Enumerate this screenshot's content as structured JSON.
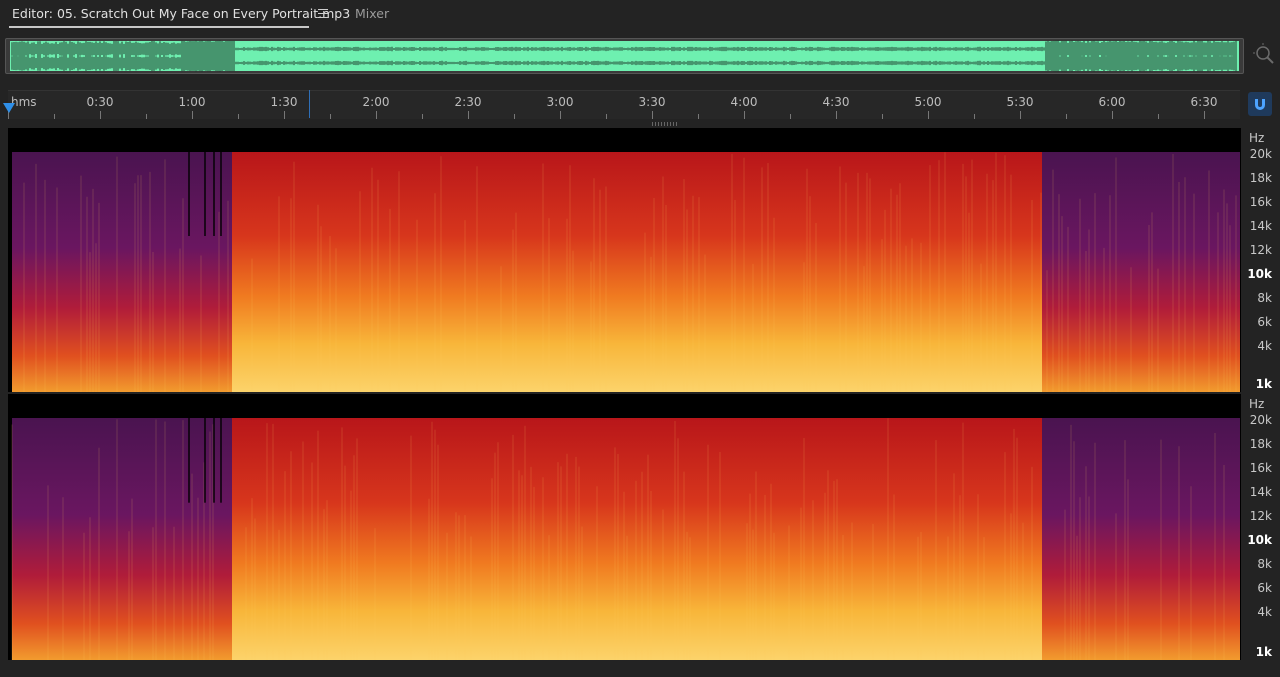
{
  "tabs": {
    "editor_label": "Editor: 05. Scratch Out My Face on Every Portrait.mp3",
    "menu_icon": "hamburger-menu-icon",
    "mixer_label": "Mixer"
  },
  "overview": {
    "waveform_color": "#6ef0b0",
    "zoom_icon": "zoom-magnifier-icon"
  },
  "ruler": {
    "unit": "hms",
    "labels": [
      "0:30",
      "1:00",
      "1:30",
      "2:00",
      "2:30",
      "3:00",
      "3:30",
      "4:00",
      "4:30",
      "5:00",
      "5:30",
      "6:00",
      "6:30"
    ],
    "snap_icon": "magnet-snap-icon",
    "accent_color": "#2f8fe8"
  },
  "channel_1": {
    "unit": "Hz",
    "labels": [
      "20k",
      "18k",
      "16k",
      "14k",
      "12k",
      "10k",
      "8k",
      "6k",
      "4k",
      "1k"
    ]
  },
  "channel_2": {
    "unit": "Hz",
    "labels": [
      "20k",
      "18k",
      "16k",
      "14k",
      "12k",
      "10k",
      "8k",
      "6k",
      "4k",
      "1k"
    ]
  }
}
